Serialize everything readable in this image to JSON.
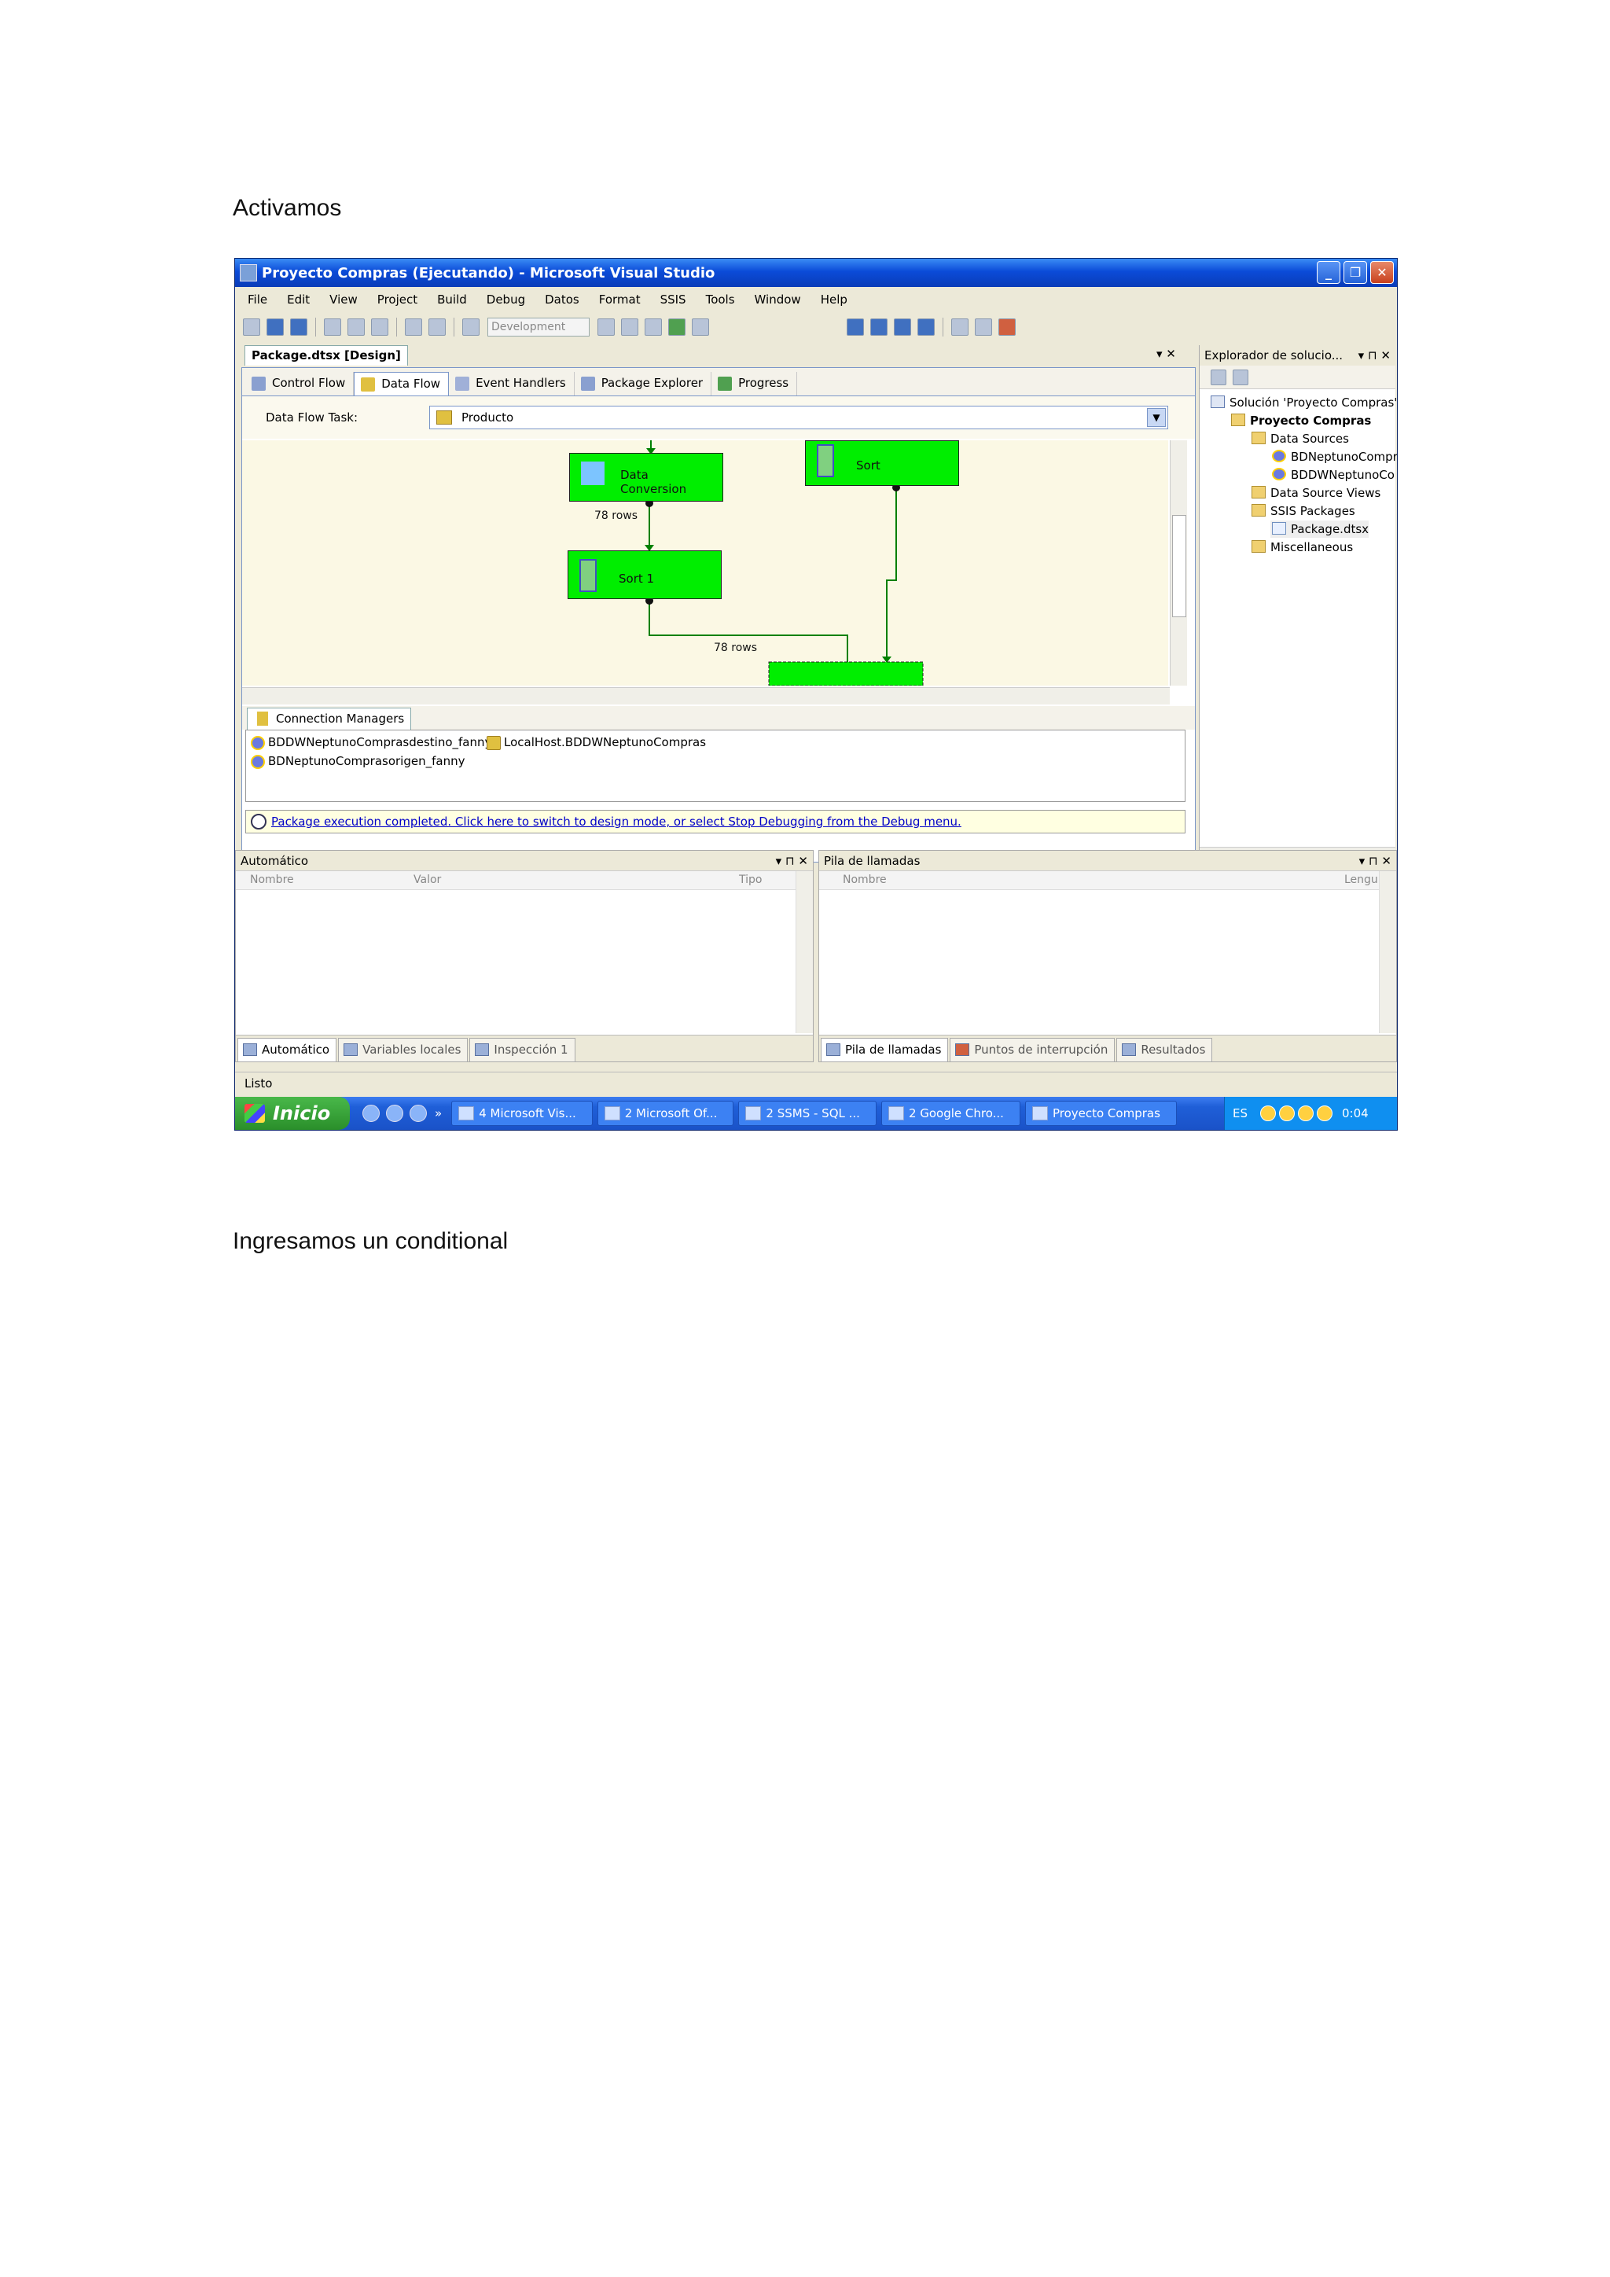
{
  "document": {
    "heading_1": "Activamos",
    "heading_2": "Ingresamos un conditional"
  },
  "window": {
    "title": "Proyecto Compras (Ejecutando) - Microsoft Visual Studio",
    "menu": [
      "File",
      "Edit",
      "View",
      "Project",
      "Build",
      "Debug",
      "Datos",
      "Format",
      "SSIS",
      "Tools",
      "Window",
      "Help"
    ],
    "config_combo": "Development",
    "doc_tab": "Package.dtsx [Design]",
    "doc_tab_controls": "▾ ✕"
  },
  "designer": {
    "tabs": [
      "Control Flow",
      "Data Flow",
      "Event Handlers",
      "Package Explorer",
      "Progress"
    ],
    "active_tab": "Data Flow",
    "task_label": "Data Flow Task:",
    "task_value": "Producto",
    "nodes": {
      "data_conversion": "Data Conversion",
      "sort": "Sort",
      "sort1": "Sort 1"
    },
    "rows_1": "78 rows",
    "rows_2": "78 rows",
    "connection_managers_tab": "Connection Managers",
    "connections": [
      "BDDWNeptunoComprasdestino_fanny",
      "LocalHost.BDDWNeptunoCompras",
      "BDNeptunoComprasorigen_fanny"
    ],
    "info_message": "Package execution completed. Click here to switch to design mode, or select Stop Debugging from the Debug menu."
  },
  "solution_explorer": {
    "title": "Explorador de solucio...",
    "controls": "▾ ⊓ ✕",
    "items": [
      "Solución 'Proyecto Compras' (",
      "Proyecto Compras",
      "Data Sources",
      "BDNeptunoCompr",
      "BDDWNeptunoCo",
      "Data Source Views",
      "SSIS Packages",
      "Package.dtsx",
      "Miscellaneous"
    ]
  },
  "debug": {
    "auto_title": "Automático",
    "auto_cols": [
      "Nombre",
      "Valor",
      "Tipo"
    ],
    "auto_tabs": [
      "Automático",
      "Variables locales",
      "Inspección 1"
    ],
    "stack_title": "Pila de llamadas",
    "stack_cols": [
      "Nombre",
      "Lengu"
    ],
    "stack_tabs": [
      "Pila de llamadas",
      "Puntos de interrupción",
      "Resultados"
    ],
    "pane_controls": "▾ ⊓ ✕"
  },
  "status": "Listo",
  "taskbar": {
    "start": "Inicio",
    "tasks": [
      "4 Microsoft Vis...",
      "2 Microsoft Of...",
      "2 SSMS - SQL ...",
      "2 Google Chro...",
      "Proyecto Compras"
    ],
    "lang": "ES",
    "clock": "0:04"
  }
}
